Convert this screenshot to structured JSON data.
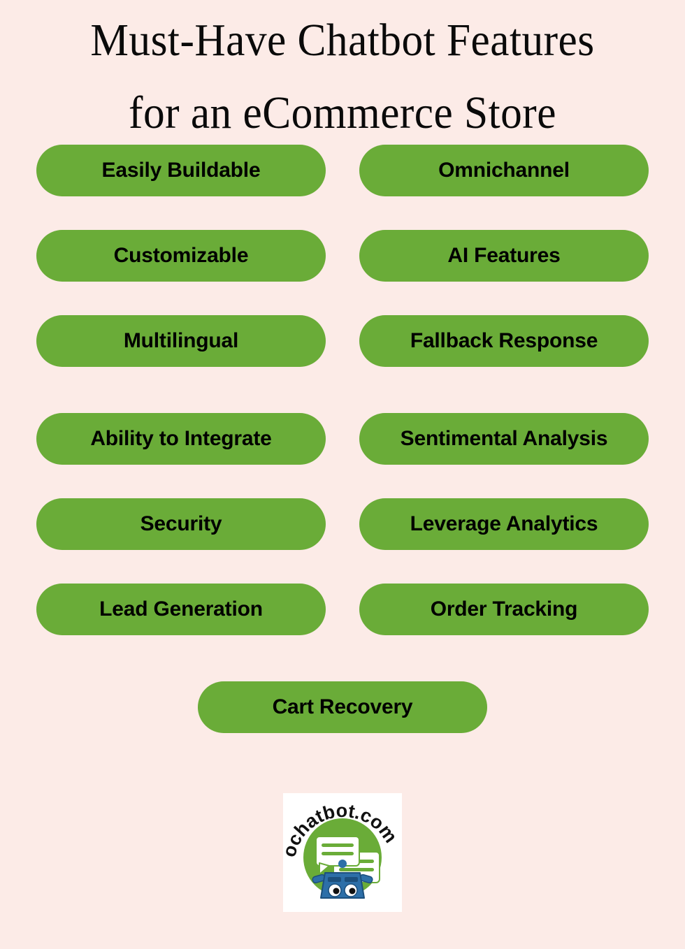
{
  "poster": {
    "background_color": "#fcebe7",
    "accent_color": "#6aac38",
    "text_color": "#000000"
  },
  "title": {
    "line1": "Must-Have Chatbot Features",
    "line2": "for an eCommerce Store"
  },
  "features": {
    "rows": [
      {
        "left": "Easily Buildable",
        "right": "Omnichannel"
      },
      {
        "left": "Customizable",
        "right": "AI Features"
      },
      {
        "left": "Multilingual",
        "right": "Fallback Response"
      },
      {
        "left": "Ability to Integrate",
        "right": "Sentimental Analysis"
      },
      {
        "left": "Security",
        "right": "Leverage Analytics"
      },
      {
        "left": "Lead Generation",
        "right": "Order Tracking"
      }
    ],
    "final": "Cart Recovery"
  },
  "logo": {
    "brand_text": "ochatbot.com",
    "letters": [
      "o",
      "c",
      "h",
      "a",
      "t",
      "b",
      "o",
      "t",
      ".",
      "c",
      "o",
      "m"
    ],
    "circle_color": "#6aac38",
    "bubble_color": "#ffffff",
    "robot_color": "#2d6fa8",
    "icon_name": "ochatbot-logo"
  }
}
